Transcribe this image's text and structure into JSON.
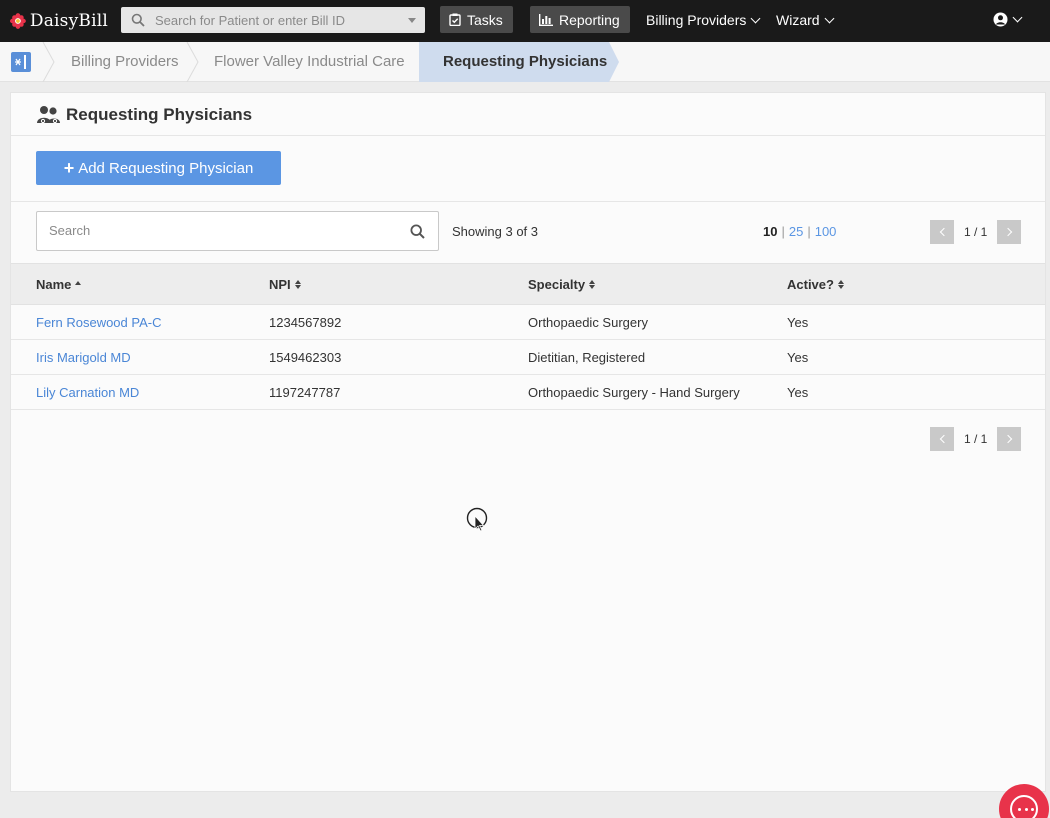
{
  "app": {
    "name": "DaisyBill"
  },
  "topbar": {
    "search_placeholder": "Search for Patient or enter Bill ID",
    "tasks_label": "Tasks",
    "reporting_label": "Reporting",
    "billing_providers_label": "Billing Providers",
    "wizard_label": "Wizard"
  },
  "breadcrumb": {
    "items": [
      "Billing Providers",
      "Flower Valley Industrial Care"
    ],
    "active": "Requesting Physicians"
  },
  "page": {
    "title": "Requesting Physicians",
    "add_button_label": "Add Requesting Physician",
    "search_placeholder": "Search",
    "showing_text": "Showing 3 of 3",
    "per_page": {
      "active": "10",
      "options": [
        "25",
        "100"
      ]
    },
    "pager_text": "1 / 1"
  },
  "table": {
    "columns": [
      "Name",
      "NPI",
      "Specialty",
      "Active?"
    ],
    "rows": [
      {
        "name": "Fern Rosewood PA-C",
        "npi": "1234567892",
        "specialty": "Orthopaedic Surgery",
        "active": "Yes"
      },
      {
        "name": "Iris Marigold MD",
        "npi": "1549462303",
        "specialty": "Dietitian, Registered",
        "active": "Yes"
      },
      {
        "name": "Lily Carnation MD",
        "npi": "1197247787",
        "specialty": "Orthopaedic Surgery - Hand Surgery",
        "active": "Yes"
      }
    ]
  },
  "colors": {
    "topbar": "#1a1a1a",
    "accent": "#5b96e3",
    "link": "#4a86d6",
    "breadcrumb_active": "#cfdcee",
    "chat": "#e8334a"
  },
  "icons": {
    "logo": "daisy-flower-icon",
    "search": "search-icon",
    "tasks": "clipboard-check-icon",
    "reporting": "bar-chart-icon",
    "user": "user-circle-icon",
    "title": "users-icon",
    "chat": "chat-bubble-icon"
  }
}
